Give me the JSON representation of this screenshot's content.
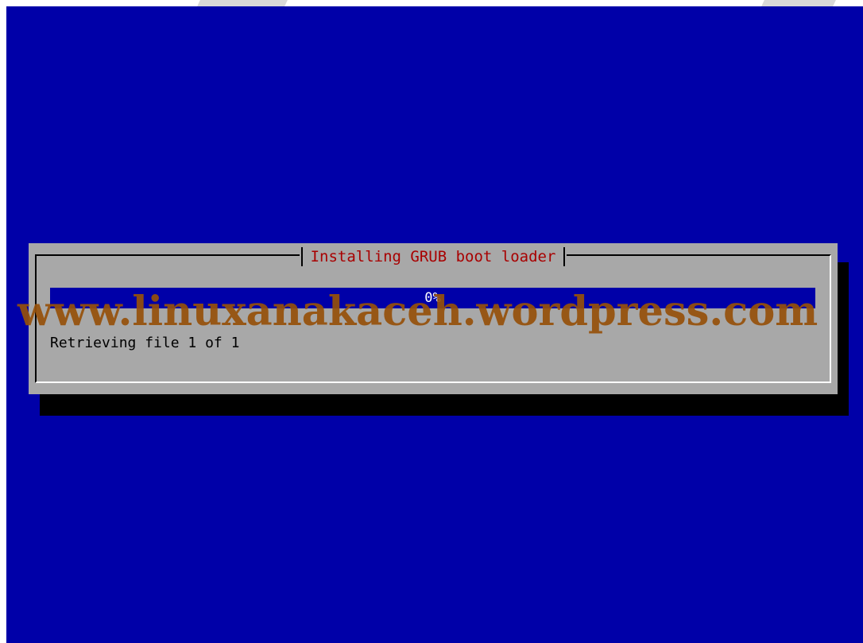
{
  "dialog": {
    "title": "Installing GRUB boot loader",
    "progress_percent": 0,
    "progress_label": "0%",
    "status": "Retrieving file 1 of 1"
  },
  "watermark": {
    "text": "www.linuxanakaceh.wordpress.com"
  },
  "colors": {
    "screen_background": "#0000a8",
    "dialog_background": "#a8a8a8",
    "title_text": "#a80000",
    "progress_fill": "#0000a8",
    "watermark": "#964f0a"
  }
}
